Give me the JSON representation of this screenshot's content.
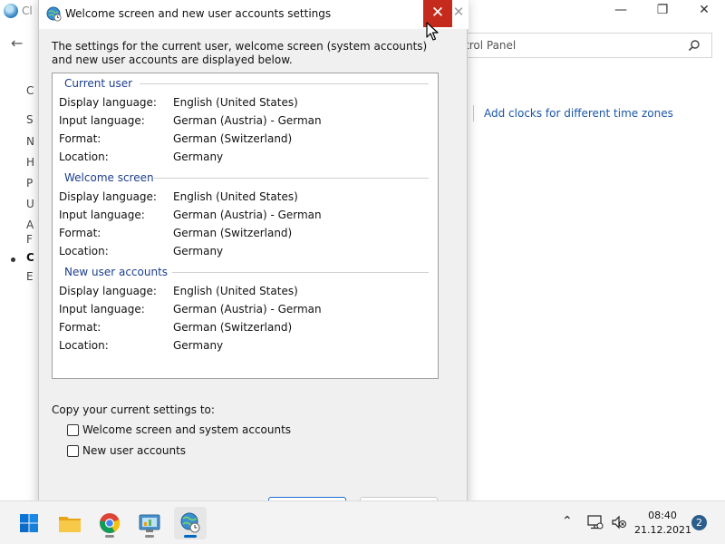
{
  "background_window": {
    "title": "Cl",
    "address_text": "trol Panel",
    "link": "Add clocks for different time zones",
    "truncated_items": [
      "C",
      "S",
      "N",
      "H",
      "P",
      "U",
      "A",
      "F",
      "C",
      "E"
    ]
  },
  "dialog": {
    "title": "Welcome screen and new user accounts settings",
    "intro": "The settings for the current user, welcome screen (system accounts) and new user accounts are displayed below.",
    "sections": [
      {
        "heading": "Current user",
        "rows": [
          {
            "label": "Display language:",
            "value": "English (United States)"
          },
          {
            "label": "Input language:",
            "value": "German (Austria) - German"
          },
          {
            "label": "Format:",
            "value": "German (Switzerland)"
          },
          {
            "label": "Location:",
            "value": "Germany"
          }
        ]
      },
      {
        "heading": "Welcome screen",
        "rows": [
          {
            "label": "Display language:",
            "value": "English (United States)"
          },
          {
            "label": "Input language:",
            "value": "German (Austria) - German"
          },
          {
            "label": "Format:",
            "value": "German (Switzerland)"
          },
          {
            "label": "Location:",
            "value": "Germany"
          }
        ]
      },
      {
        "heading": "New user accounts",
        "rows": [
          {
            "label": "Display language:",
            "value": "English (United States)"
          },
          {
            "label": "Input language:",
            "value": "German (Austria) - German"
          },
          {
            "label": "Format:",
            "value": "German (Switzerland)"
          },
          {
            "label": "Location:",
            "value": "Germany"
          }
        ]
      }
    ],
    "copy_label": "Copy your current settings to:",
    "checkboxes": [
      {
        "label": "Welcome screen and system accounts",
        "checked": false
      },
      {
        "label": "New user accounts",
        "checked": false
      }
    ]
  },
  "taskbar": {
    "apps": [
      "start-icon",
      "file-explorer-icon",
      "chrome-icon",
      "control-panel-icon",
      "region-settings-icon"
    ],
    "time": "08:40",
    "date": "21.12.2021",
    "notification_count": "2"
  },
  "colors": {
    "close_red": "#c42b1c",
    "section_heading": "#1c3e8e",
    "link_blue": "#1a56a8",
    "accent": "#0067c0"
  }
}
